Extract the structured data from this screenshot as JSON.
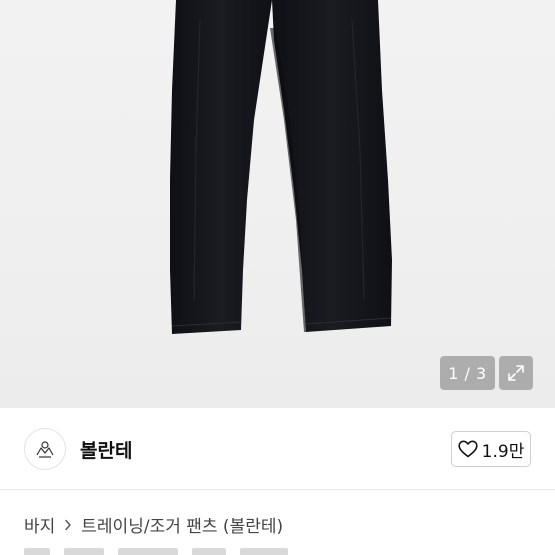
{
  "gallery": {
    "counter": "1 / 3",
    "image_label": "black-pants-product-photo",
    "expand_icon": "expand-icon"
  },
  "shop": {
    "logo_icon": "shop-logo-icon",
    "name": "볼란테",
    "likes": "1.9만",
    "like_icon": "heart-outline-icon"
  },
  "breadcrumb": {
    "items": [
      "바지",
      "트레이닝/조거 팬츠 (볼란테)"
    ],
    "separator_icon": "chevron-right-icon"
  },
  "colors": {
    "pants": "#14161c",
    "background": "#efefef",
    "overlay": "#7a7a7a"
  }
}
